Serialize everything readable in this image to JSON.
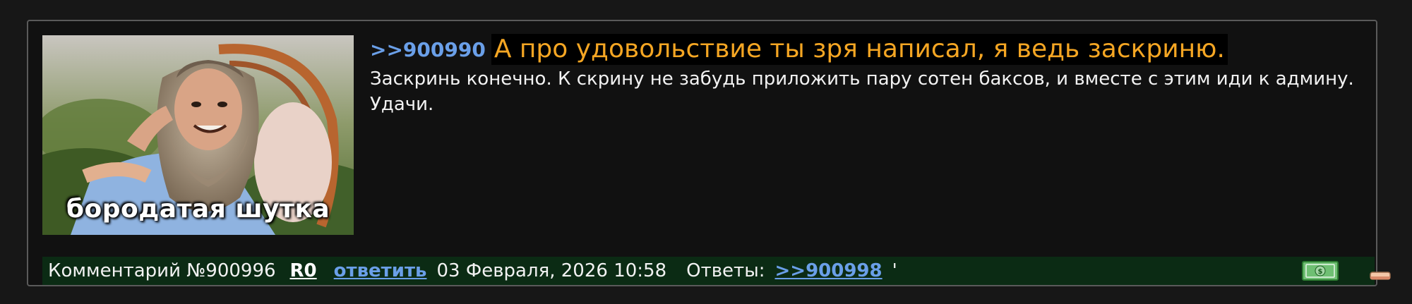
{
  "post": {
    "image": {
      "caption": "бородатая шутка"
    },
    "quote_ref": ">>900990",
    "quoted_text": "А про удовольствие ты зря написал, я ведь заскриню.",
    "body": "Заскринь конечно. К скрину не забудь приложить пару сотен баксов, и вместе с этим иди к админу. Удачи.",
    "footer": {
      "comment_label": "Комментарий №900996",
      "rating": "R0",
      "reply_label": "ответить",
      "date": "03 Февраля, 2026 10:58",
      "replies_label": "Ответы:",
      "reply_ref": ">>900998",
      "trailing_mark": "'"
    },
    "icons": {
      "money": "money-icon",
      "eraser": "eraser-icon"
    }
  },
  "colors": {
    "page_bg": "#171717",
    "post_bg": "#111111",
    "link": "#6a9fe8",
    "quote": "#f5a623",
    "footer_bg": "#0b2b14"
  }
}
